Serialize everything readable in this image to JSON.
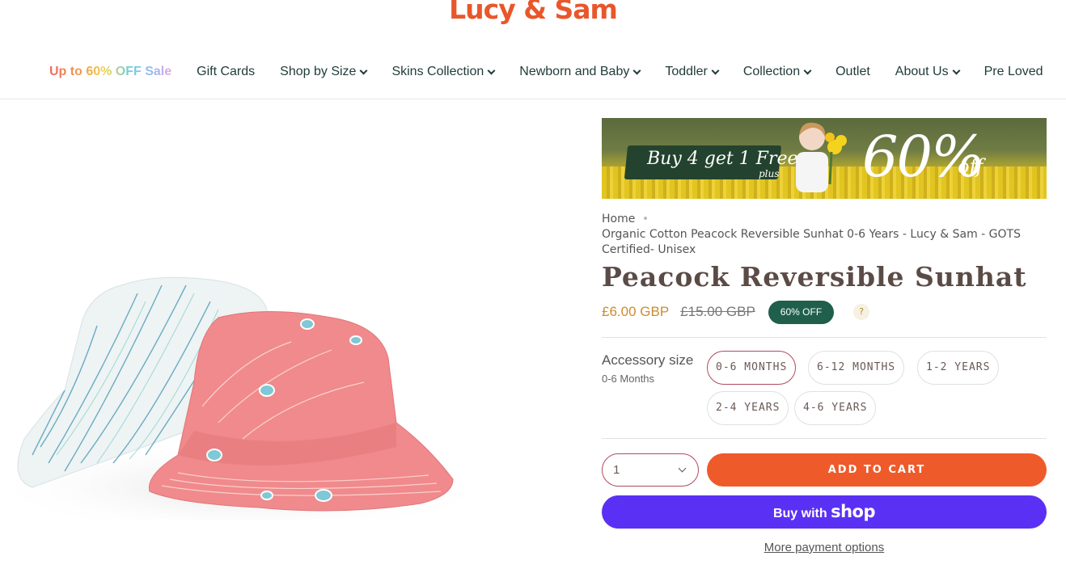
{
  "brand": {
    "logo_text": "Lucy & Sam",
    "accent": "#e8572b"
  },
  "nav": {
    "items": [
      {
        "label": "Up to 60% OFF Sale",
        "dropdown": false
      },
      {
        "label": "Gift Cards",
        "dropdown": false
      },
      {
        "label": "Shop by Size",
        "dropdown": true
      },
      {
        "label": "Skins Collection",
        "dropdown": true
      },
      {
        "label": "Newborn and Baby",
        "dropdown": true
      },
      {
        "label": "Toddler",
        "dropdown": true
      },
      {
        "label": "Collection",
        "dropdown": true
      },
      {
        "label": "Outlet",
        "dropdown": false
      },
      {
        "label": "About Us",
        "dropdown": true
      },
      {
        "label": "Pre Loved",
        "dropdown": false
      }
    ]
  },
  "banner": {
    "tag_text": "Buy 4 get 1 Free",
    "plus_text": "plus",
    "big_text": "60%",
    "off_text": "off"
  },
  "breadcrumb": {
    "home": "Home",
    "current": "Organic Cotton Peacock Reversible Sunhat 0-6 Years - Lucy & Sam - GOTS Certified- Unisex"
  },
  "product": {
    "title": "Peacock Reversible Sunhat",
    "price": "£6.00 GBP",
    "compare_price": "£15.00 GBP",
    "discount_badge": "60% OFF",
    "help_icon": "?",
    "price_color": "#d08a2e",
    "badge_color": "#1f5f4b"
  },
  "size": {
    "label": "Accessory size",
    "selected": "0-6 Months",
    "options": [
      "0-6 MONTHS",
      "6-12 MONTHS",
      "1-2 YEARS",
      "2-4 YEARS",
      "4-6 YEARS"
    ]
  },
  "cart": {
    "quantity": "1",
    "add_label": "ADD TO CART",
    "add_color": "#ef5a2a",
    "shop_pay_prefix": "Buy with",
    "shop_pay_brand": "shop",
    "shop_pay_color": "#5a31f4",
    "more_options": "More payment options"
  }
}
